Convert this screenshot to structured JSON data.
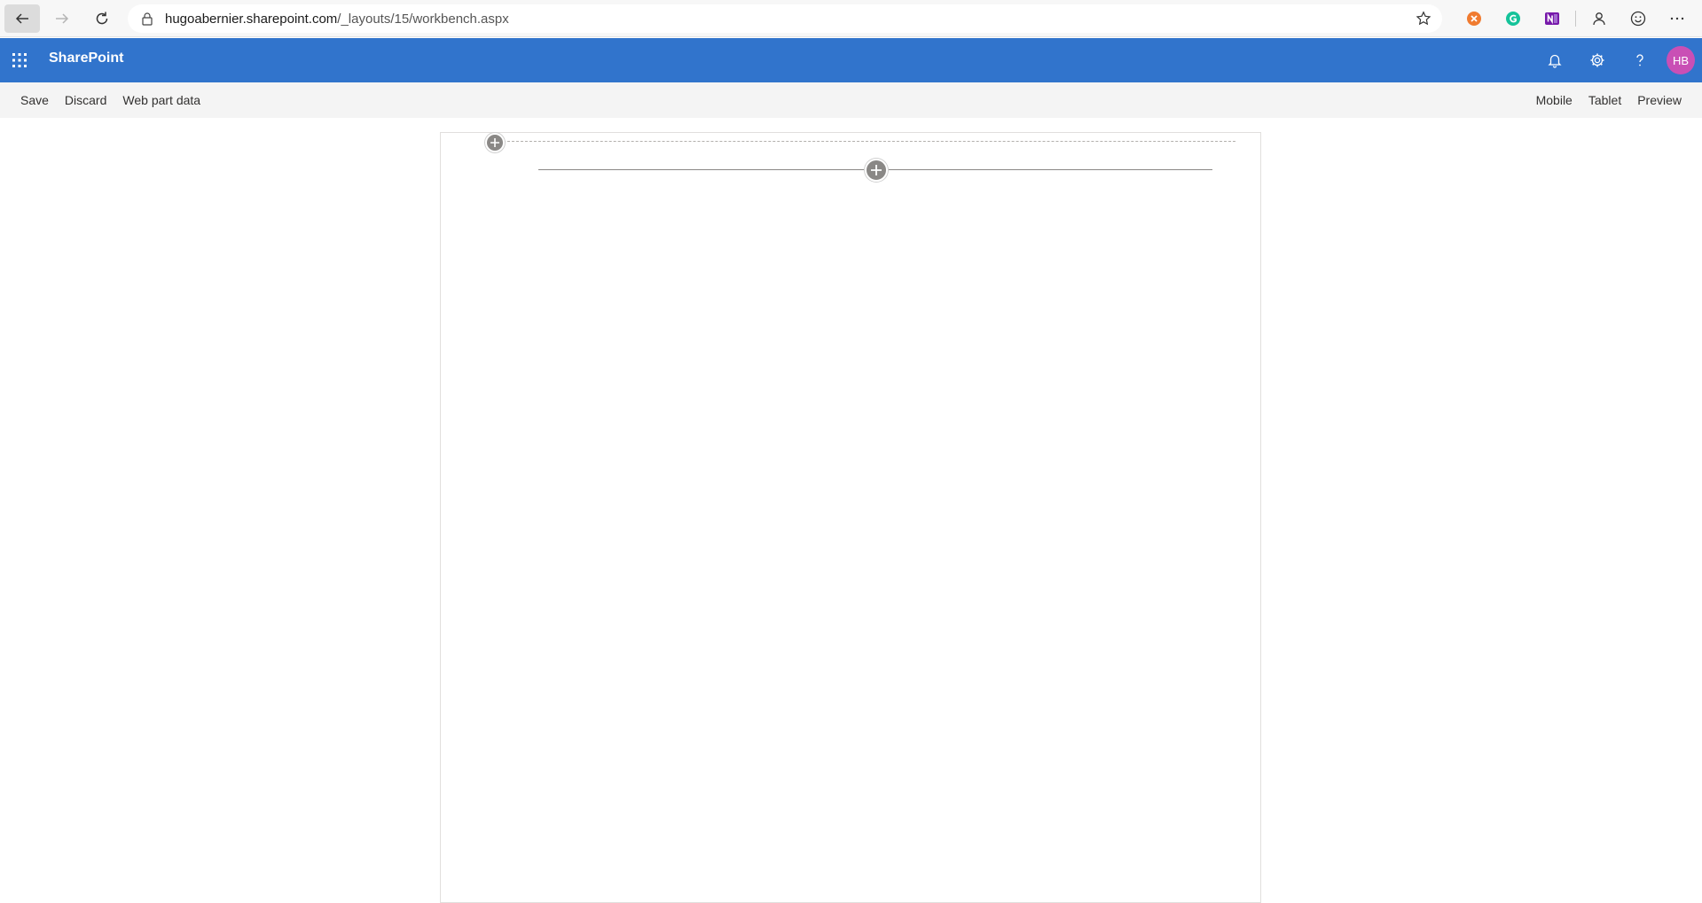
{
  "browser": {
    "url_host": "hugoabernier.sharepoint.com",
    "url_path": "/_layouts/15/workbench.aspx",
    "back_icon": "back-arrow-icon",
    "forward_icon": "forward-arrow-icon",
    "refresh_icon": "refresh-icon",
    "extensions": [
      "extension-orange-icon",
      "grammarly-icon",
      "onenote-icon",
      "profile-icon",
      "feedback-smiley-icon",
      "more-icon"
    ]
  },
  "suite_bar": {
    "title": "SharePoint",
    "avatar_initials": "HB",
    "accent_color": "#3174cc",
    "avatar_color": "#c94fb5"
  },
  "command_bar": {
    "save_label": "Save",
    "discard_label": "Discard",
    "web_part_data_label": "Web part data",
    "mobile_label": "Mobile",
    "tablet_label": "Tablet",
    "preview_label": "Preview"
  }
}
